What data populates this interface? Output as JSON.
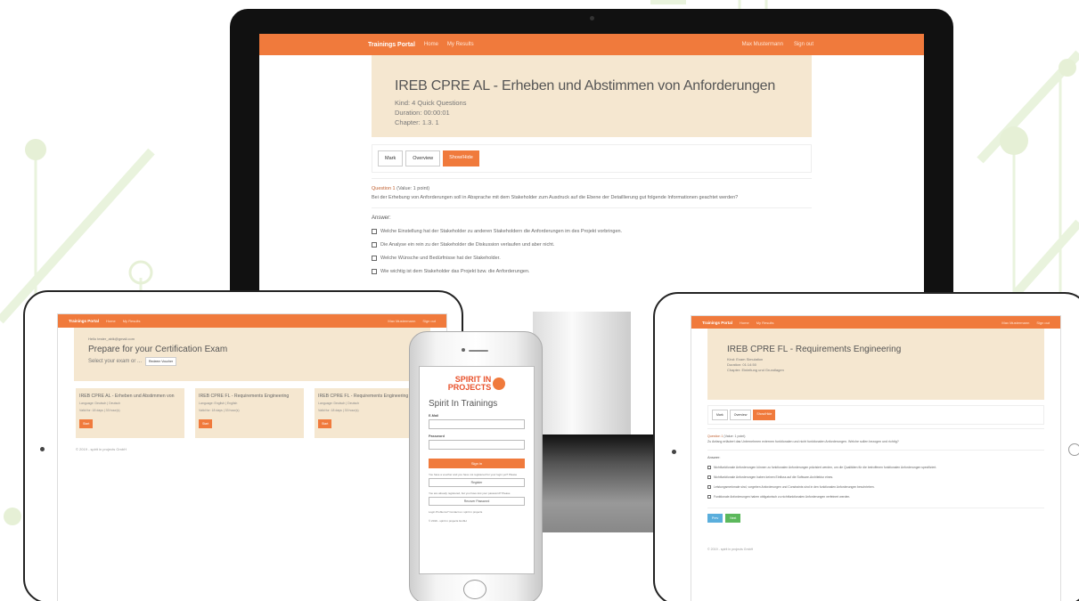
{
  "brand": "Trainings Portal",
  "colors": {
    "accent": "#f07a3c",
    "header_bg": "#f5e7d0",
    "deco_green": "#e8f2d8"
  },
  "desktop": {
    "nav": {
      "links": [
        "Home",
        "My Results"
      ],
      "right": [
        "Max Mustermann",
        "Sign out"
      ]
    },
    "title": "IREB CPRE AL - Erheben und Abstimmen von Anforderungen",
    "meta": [
      "Kind: 4 Quick Questions",
      "Duration: 00:00:01",
      "Chapter: 1.3. 1"
    ],
    "tabs": [
      "Mark",
      "Overview",
      "Show/Hide"
    ],
    "question_label": "Question 1",
    "question_points": "(Value: 1 point)",
    "question_text": "Bei der Erhebung von Anforderungen soll in Absprache mit dem Stakeholder zum Ausdruck auf die Ebene der Detaillierung gut folgende Informationen geachtet werden?",
    "answer_label": "Answer:",
    "answers": [
      "Welche Einstellung hat der Stakeholder zu anderen Stakeholdern die Anforderungen im des Projekt vorbringen.",
      "Die Analyse ein rein zu der Stakeholder die Diskussion verlaufen und aber nicht.",
      "Welche Wünsche und Bedürfnisse hat der Stakeholder.",
      "Wie wichtig ist dem Stakeholder das Projekt bzw. die Anforderungen."
    ]
  },
  "tablet_left": {
    "nav": {
      "links": [
        "Home",
        "My Results"
      ],
      "right": [
        "Max Mustermann",
        "Sign out"
      ]
    },
    "hello": "Hello tester_ablk@gmail.com",
    "heading": "Prepare for your Certification Exam",
    "select_text": "Select your exam or ...",
    "select_btn": "Redeem Voucher",
    "cards": [
      {
        "title": "IREB CPRE AL - Erheben und Abstimmen von",
        "lang": "Language: Deutsch | Deutsch",
        "dur": "Valid for: 18 days | 33 hour(s)",
        "btn": "Start"
      },
      {
        "title": "IREB CPRE FL - Requirements Engineering",
        "lang": "Language: English | English",
        "dur": "Valid for: 18 days | 33 hour(s)",
        "btn": "Start"
      },
      {
        "title": "IREB CPRE FL - Requirements Engineering",
        "lang": "Language: Deutsch | Deutsch",
        "dur": "Valid for: 18 days | 33 hour(s)",
        "btn": "Start"
      }
    ],
    "footer": "© 2019 - spirit in projects GmbH"
  },
  "phone": {
    "logo_line1": "SPIRIT IN",
    "logo_line2": "PROJECTS",
    "title": "Spirit In Trainings",
    "email_label": "E-Mail",
    "password_label": "Password",
    "signin": "Sign in",
    "register_text": "You have a voucher and you have not registered for your login yet? Please",
    "register_btn": "Register",
    "forgot_text": "You are already registered, but you have lost your password? Please",
    "forgot_btn": "Recover Password",
    "contact_text": "Login Problems? Contact us: spirit in projects",
    "footer": "© 2019 - spirit in projects GmbH"
  },
  "tablet_right": {
    "nav": {
      "links": [
        "Home",
        "My Results"
      ],
      "right": [
        "Max Mustermann",
        "Sign out"
      ]
    },
    "title": "IREB CPRE FL - Requirements Engineering",
    "meta": [
      "Kind: Exam Simulation",
      "Duration: 01:14:50",
      "Chapter: Einleitung und Grundlagen"
    ],
    "tabs": [
      "Mark",
      "Overview",
      "Show/Hide"
    ],
    "question_label": "Question 1",
    "question_points": "(Value: 1 point)",
    "question_text": "Zu Anfang erläutert das Unternehmen externen funktionalen und nicht funktionalen Anforderungen. Welche sollen bezogen und richtig?",
    "answer_label": "Answer:",
    "answers": [
      "Nichtfunktionale Anforderungen können zu funktionalen Anforderungen präzisiert werden, um die Qualitäten für die betroffenen funktionalen Anforderungen spezifiziert.",
      "Nichtfunktionale Anforderungen haben keinen Einfluss auf die Software-Architektur eines.",
      "Leistungsmerkmale sind, vorgeben Anforderungen und Constraints sind in den funktionalen Anforderungen beschrieben.",
      "Funktionale Anforderungen haben obligatorisch zu nichtfunktionalen Anforderungen verfeinert werden."
    ],
    "buttons": [
      "Prev",
      "Next"
    ],
    "footer": "© 2019 - spirit in projects GmbH"
  }
}
